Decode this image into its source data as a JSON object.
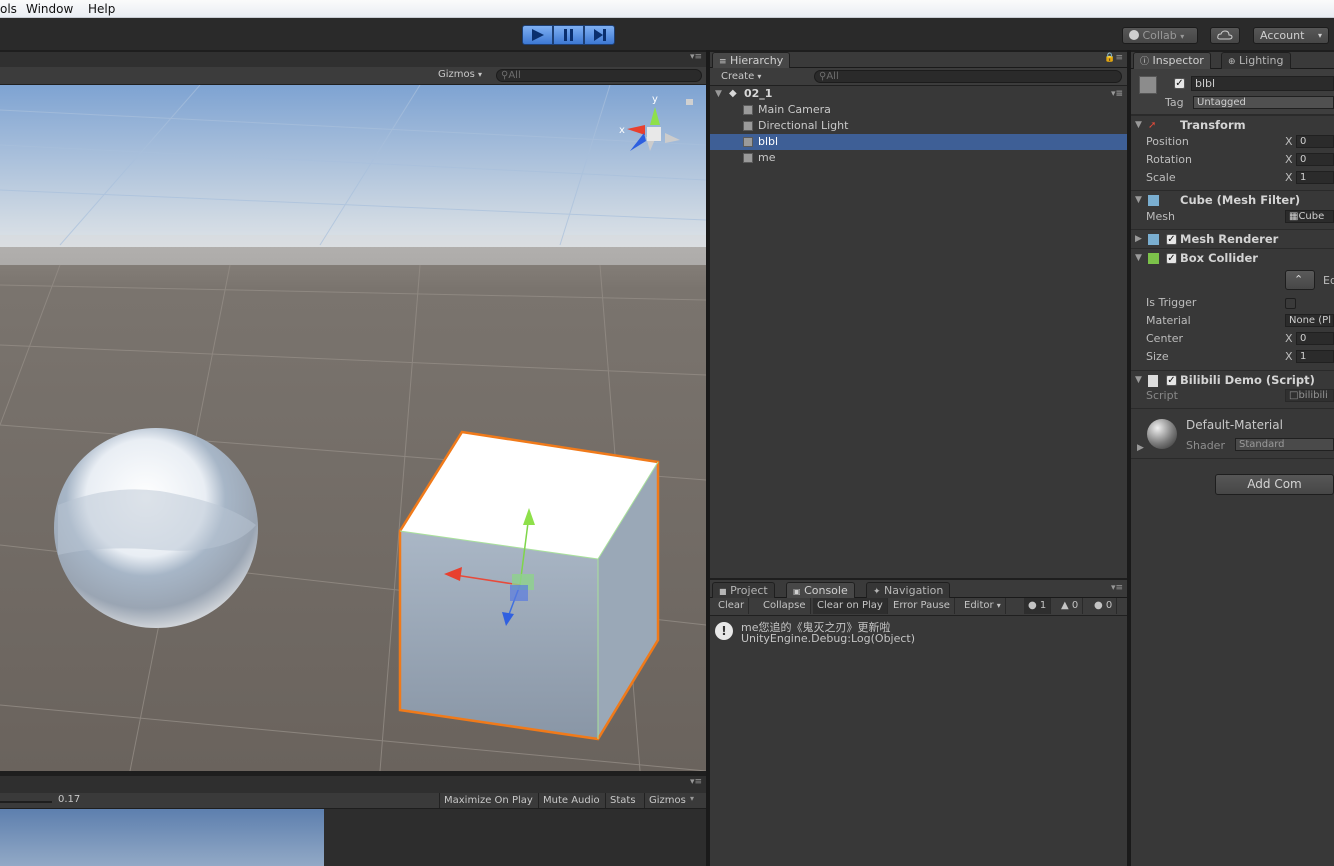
{
  "menu": {
    "items": [
      "ols",
      "Window",
      "Help"
    ]
  },
  "toolbar": {
    "collab_label": "Collab",
    "account_label": "Account"
  },
  "scene": {
    "gizmos_label": "Gizmos",
    "search_placeholder": "All",
    "axis_y": "y",
    "axis_x": "x"
  },
  "hierarchy": {
    "tab_label": "Hierarchy",
    "create_label": "Create",
    "search_placeholder": "All",
    "scene_name": "02_1",
    "items": [
      {
        "label": "Main Camera",
        "selected": false
      },
      {
        "label": "Directional Light",
        "selected": false
      },
      {
        "label": "blbl",
        "selected": true
      },
      {
        "label": "me",
        "selected": false
      }
    ]
  },
  "console": {
    "tabs": [
      "Project",
      "Console",
      "Navigation"
    ],
    "buttons": [
      "Clear",
      "Collapse",
      "Clear on Play",
      "Error Pause",
      "Editor"
    ],
    "counts": {
      "info": "1",
      "warn": "0",
      "error": "0"
    },
    "message_line1": "me您追的《鬼灭之刃》更新啦",
    "message_line2": "UnityEngine.Debug:Log(Object)"
  },
  "inspector": {
    "tabs": [
      "Inspector",
      "Lighting"
    ],
    "object_name": "blbl",
    "tag_label": "Tag",
    "tag_value": "Untagged",
    "transform": {
      "title": "Transform",
      "rows": [
        {
          "label": "Position",
          "axis": "X",
          "value": "0"
        },
        {
          "label": "Rotation",
          "axis": "X",
          "value": "0"
        },
        {
          "label": "Scale",
          "axis": "X",
          "value": "1"
        }
      ]
    },
    "mesh_filter": {
      "title": "Cube (Mesh Filter)",
      "mesh_label": "Mesh",
      "mesh_value": "Cube"
    },
    "mesh_renderer": {
      "title": "Mesh Renderer"
    },
    "box_collider": {
      "title": "Box Collider",
      "edit_label": "Ed",
      "is_trigger_label": "Is Trigger",
      "material_label": "Material",
      "material_value": "None (Pl",
      "center_label": "Center",
      "center_axis": "X",
      "center_value": "0",
      "size_label": "Size",
      "size_axis": "X",
      "size_value": "1"
    },
    "script": {
      "title": "Bilibili Demo (Script)",
      "script_label": "Script",
      "script_value": "bilibili"
    },
    "material": {
      "name": "Default-Material",
      "shader_label": "Shader",
      "shader_value": "Standard"
    },
    "add_component_label": "Add Com"
  },
  "game": {
    "scale_value": "0.17",
    "buttons": [
      "Maximize On Play",
      "Mute Audio",
      "Stats",
      "Gizmos"
    ]
  }
}
